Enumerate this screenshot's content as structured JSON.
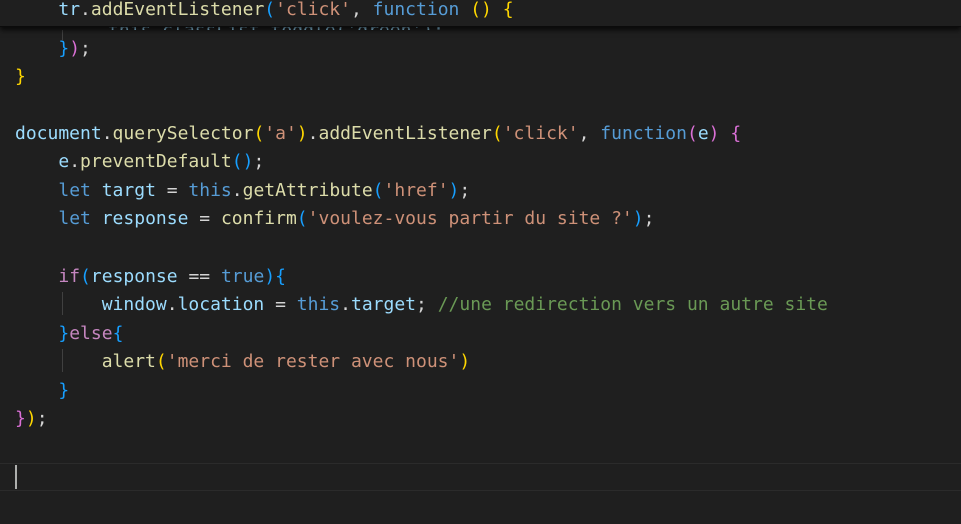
{
  "sticky_scroll": {
    "indent": "    ",
    "object": "tr",
    "method": "addEventListener",
    "arg": "'click'",
    "keyword": "function"
  },
  "code": {
    "line_close_fn": "});",
    "line_close_block": "}",
    "query": {
      "object": "document",
      "method1": "querySelector",
      "arg1": "'a'",
      "method2": "addEventListener",
      "arg2": "'click'",
      "keyword": "function",
      "param": "e"
    },
    "prevent": {
      "object": "e",
      "method": "preventDefault"
    },
    "targt": {
      "keyword": "let",
      "name": "targt",
      "this": "this",
      "method": "getAttribute",
      "arg": "'href'"
    },
    "response": {
      "keyword": "let",
      "name": "response",
      "method": "confirm",
      "arg": "'voulez-vous partir du site ?'"
    },
    "if": {
      "keyword": "if",
      "name": "response",
      "op": "==",
      "value": "true"
    },
    "redirect": {
      "object": "window",
      "prop": "location",
      "this": "this",
      "target": "target",
      "comment": "//une redirection vers un autre site"
    },
    "else": {
      "keyword": "else"
    },
    "alert": {
      "method": "alert",
      "arg": "'merci de rester avec nous'"
    }
  },
  "colors": {
    "background": "#1f1f1f",
    "keyword": "#569cd6",
    "control": "#c586c0",
    "variable": "#9cdcfe",
    "function": "#dcdcaa",
    "string": "#ce9178",
    "comment": "#6a9955",
    "bracket_1": "#ffd700",
    "bracket_2": "#da70d6",
    "bracket_3": "#179fff"
  }
}
